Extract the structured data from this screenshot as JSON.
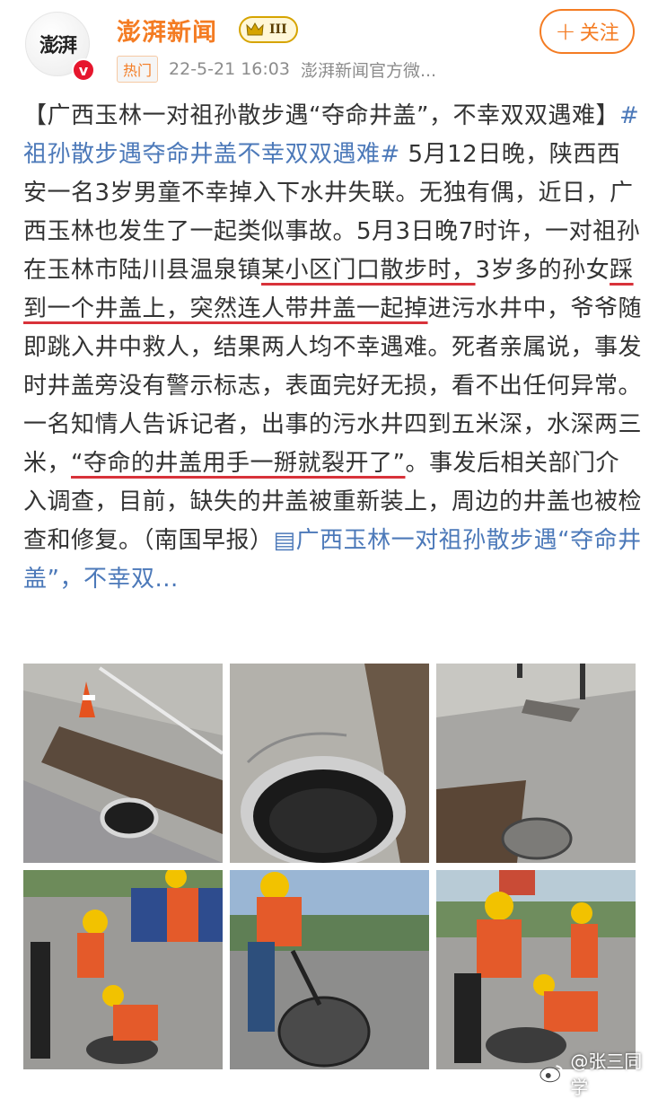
{
  "post": {
    "author": "澎湃新闻",
    "avatar_text": "澎湃",
    "verified_badge": "v",
    "level_badge": "III",
    "hot_tag": "热门",
    "timestamp": "22-5-21 16:03",
    "source": "澎湃新闻官方微...",
    "follow_label": "关注",
    "follow_icon": "+"
  },
  "body": {
    "p1": "【广西玉林一对祖孙散步遇“夺命井盖”，不幸双双遇难】",
    "hashtag": "#祖孙散步遇夺命井盖不幸双双遇难#",
    "p2": " 5月12日晚，陕西西安一名3岁男童不幸掉入下水井失联。无独有偶，近日，广西玉林也发生了一起类似事故。5月3日晚7时许，一对祖孙在玉林市陆川县温泉镇",
    "u1": "某小区门口散步时，",
    "p3": "3岁多的孙女",
    "u2": "踩到一个井盖上，",
    "u3": "突然连人带井盖一起掉",
    "p4": "进污水井中，爷爷随即跳入井中救人，结果两人均不幸遇难。死者亲属说，事发时井盖旁没有警示标志，表面完好无损，看不出任何异常。一名知情人告诉记者，出事的污水井四到五米深，水深两三米，",
    "u4": "“夺命的井盖用手一掰就裂开了”",
    "p5": "。事发后相关部门介入调查，目前，缺失的井盖被重新装上，周边的井盖也被检查和修复。（南国早报）",
    "article_icon": "▤",
    "article_link": "广西玉林一对祖孙散步遇“夺命井盖”，不幸双..."
  },
  "images": [
    {
      "name": "photo-open-manhole-sidewalk"
    },
    {
      "name": "photo-manhole-closeup"
    },
    {
      "name": "photo-manhole-street-view"
    },
    {
      "name": "photo-workers-inspecting"
    },
    {
      "name": "photo-worker-lifting-cover"
    },
    {
      "name": "photo-workers-repairing"
    }
  ],
  "watermark": {
    "text": "@张三同学",
    "icon": "weibo-icon"
  },
  "colors": {
    "accent": "#f47c23",
    "link": "#4c79b9",
    "underline": "#d8323a",
    "verified": "#e6162d"
  }
}
